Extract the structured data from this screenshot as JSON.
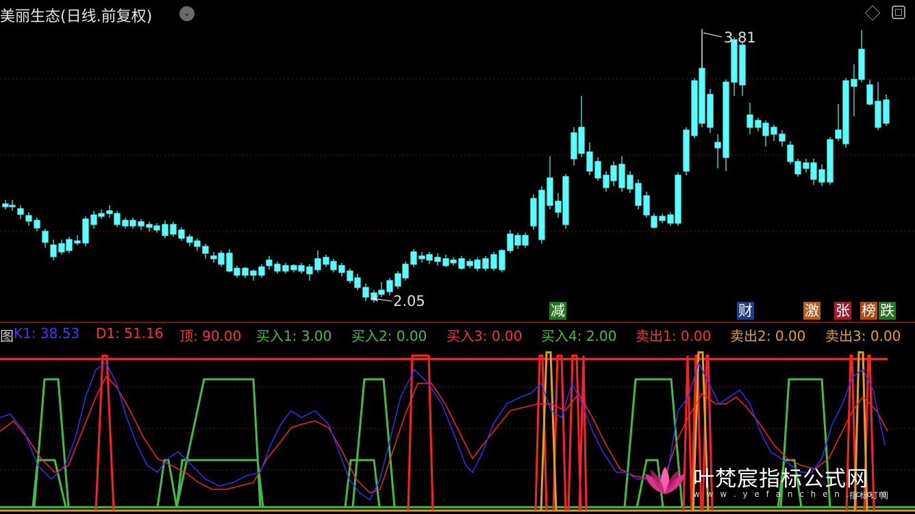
{
  "header": {
    "title": "美丽生态(日线.前复权)",
    "dropdown_glyph": "⌄"
  },
  "price_panel": {
    "high_label": "3.81",
    "low_label": "2.05",
    "up_color": "#ff3030",
    "down_color": "#54ffff"
  },
  "signal_tags": [
    {
      "text": "减",
      "color": "#ffffff",
      "bg": "#1f7a1f"
    },
    {
      "text": "财",
      "color": "#ffffff",
      "bg": "#1c3f8c"
    },
    {
      "text": "激",
      "color": "#ffffff",
      "bg": "#c05a1a"
    },
    {
      "text": "张",
      "color": "#ffffff",
      "bg": "#a11d2a"
    },
    {
      "text": "榜",
      "color": "#ffffff",
      "bg": "#b04a10"
    },
    {
      "text": "跌",
      "color": "#ffffff",
      "bg": "#1f7a1f"
    }
  ],
  "indicator_legend": [
    {
      "text": "图",
      "color": "#cccccc"
    },
    {
      "text": "K1: 38.53",
      "color": "#3a3aff"
    },
    {
      "text": "D1: 51.16",
      "color": "#ff3030"
    },
    {
      "text": "顶: 90.00",
      "color": "#ff3030"
    },
    {
      "text": "买入1: 3.00",
      "color": "#40c040"
    },
    {
      "text": "买入2: 0.00",
      "color": "#40c040"
    },
    {
      "text": "买入3: 0.00",
      "color": "#ff3030"
    },
    {
      "text": "买入4: 2.00",
      "color": "#40c040"
    },
    {
      "text": "卖出1: 0.00",
      "color": "#ff3030"
    },
    {
      "text": "卖出2: 0.00",
      "color": "#e0a020"
    },
    {
      "text": "卖出3: 0.00",
      "color": "#e0a020"
    }
  ],
  "watermark": {
    "name": "叶梵宸指标公式网",
    "url": "w w w . y e f a n c h e n . c o m",
    "sub": "指标订阅"
  }
}
